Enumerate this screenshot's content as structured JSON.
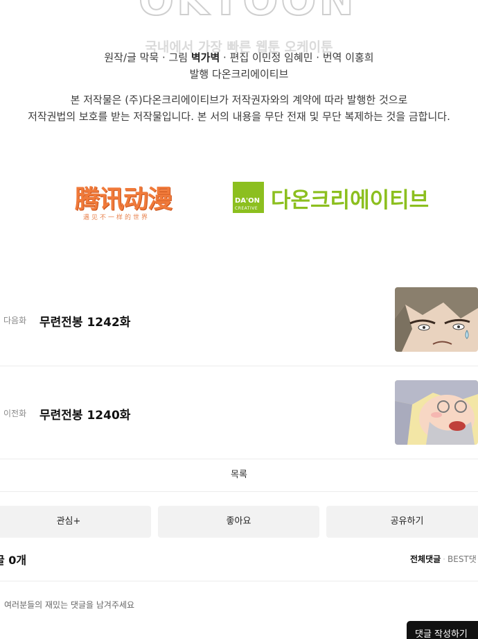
{
  "watermark": {
    "logo": "OKTOON",
    "tagline": "국내에서 가장 빠른 웹툰 오케이툰"
  },
  "credits": {
    "line1_prefix": "원작/글 막묵 · 그림 ",
    "line1_artist": "벽가벽",
    "line1_suffix": " · 편집 이민정 임혜민 · 번역 이홍희",
    "line2": "발행 다온크리에이티브",
    "notice_line1": "본 저작물은 (주)다온크리에이티브가 저작권자와의 계약에 따라 발행한 것으로",
    "notice_line2": "저작권법의 보호를 받는 저작물입니다. 본 서의 내용을 무단 전재 및 무단 복제하는 것을 금합니다."
  },
  "publishers": {
    "tencent_logo_text": "腾讯动漫",
    "tencent_sub_text": "遇见不一样的世界",
    "daon_box_text": "DA'ON",
    "daon_box_sub": "CREATIVE",
    "daon_name": "다온크리에이티브"
  },
  "episodes": {
    "next": {
      "tag": "다음화",
      "title": "무련전봉 1242화"
    },
    "prev": {
      "tag": "이전화",
      "title": "무련전봉 1240화"
    }
  },
  "nav": {
    "list_label": "목록"
  },
  "actions": {
    "favorite": "관심+",
    "like": "좋아요",
    "share": "공유하기"
  },
  "comments": {
    "count_label": "글 0개",
    "sort_all": "전체댓글",
    "sort_best": "BEST댓",
    "placeholder": "여러분들의 재밌는 댓글을 남겨주세요",
    "write_button": "댓글 작성하기"
  }
}
